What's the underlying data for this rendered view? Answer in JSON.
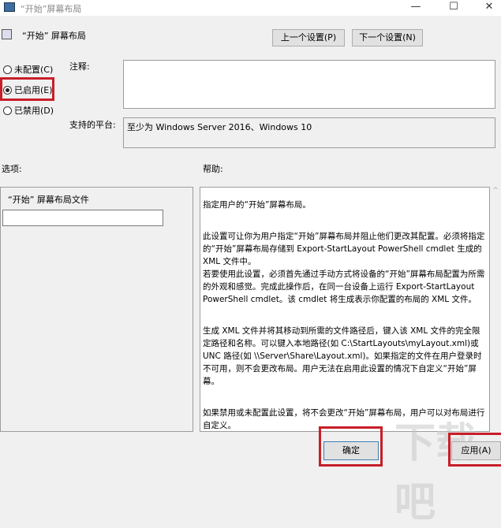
{
  "window": {
    "title": "“开始”屏幕布局",
    "minimize": "—",
    "maximize": "☐",
    "close": "✕"
  },
  "header": {
    "title": "“开始” 屏幕布局",
    "prev_button": "上一个设置(P)",
    "next_button": "下一个设置(N)"
  },
  "radios": [
    {
      "label": "未配置(C)",
      "checked": false
    },
    {
      "label": "已启用(E)",
      "checked": true
    },
    {
      "label": "已禁用(D)",
      "checked": false
    }
  ],
  "comment": {
    "label": "注释:",
    "value": ""
  },
  "platform": {
    "label": "支持的平台:",
    "value": "至少为 Windows Server 2016、Windows 10"
  },
  "options": {
    "label": "选项:",
    "field_label": "“开始” 屏幕布局文件",
    "field_value": ""
  },
  "help": {
    "label": "帮助:",
    "paragraphs": [
      "指定用户的“开始”屏幕布局。",
      "此设置可让你为用户指定“开始”屏幕布局并阻止他们更改其配置。必须将指定的“开始”屏幕布局存储到 Export-StartLayout PowerShell cmdlet 生成的 XML 文件中。\n若要使用此设置，必须首先通过手动方式将设备的“开始”屏幕布局配置为所需的外观和感觉。完成此操作后，在同一台设备上运行 Export-StartLayout PowerShell cmdlet。该 cmdlet 将生成表示你配置的布局的 XML 文件。",
      "生成 XML 文件并将其移动到所需的文件路径后，键入该 XML 文件的完全限定路径和名称。可以键入本地路径(如 C:\\StartLayouts\\myLayout.xml)或 UNC 路径(如 \\\\Server\\Share\\Layout.xml)。如果指定的文件在用户登录时不可用，则不会更改布局。用户无法在启用此设置的情况下自定义“开始”屏幕。",
      "如果禁用或未配置此设置，将不会更改“开始”屏幕布局，用户可以对布局进行自定义。"
    ]
  },
  "footer": {
    "ok": "确定",
    "apply": "应用(A)"
  },
  "watermark": "下载吧",
  "colors": {
    "highlight": "#c81e28"
  }
}
